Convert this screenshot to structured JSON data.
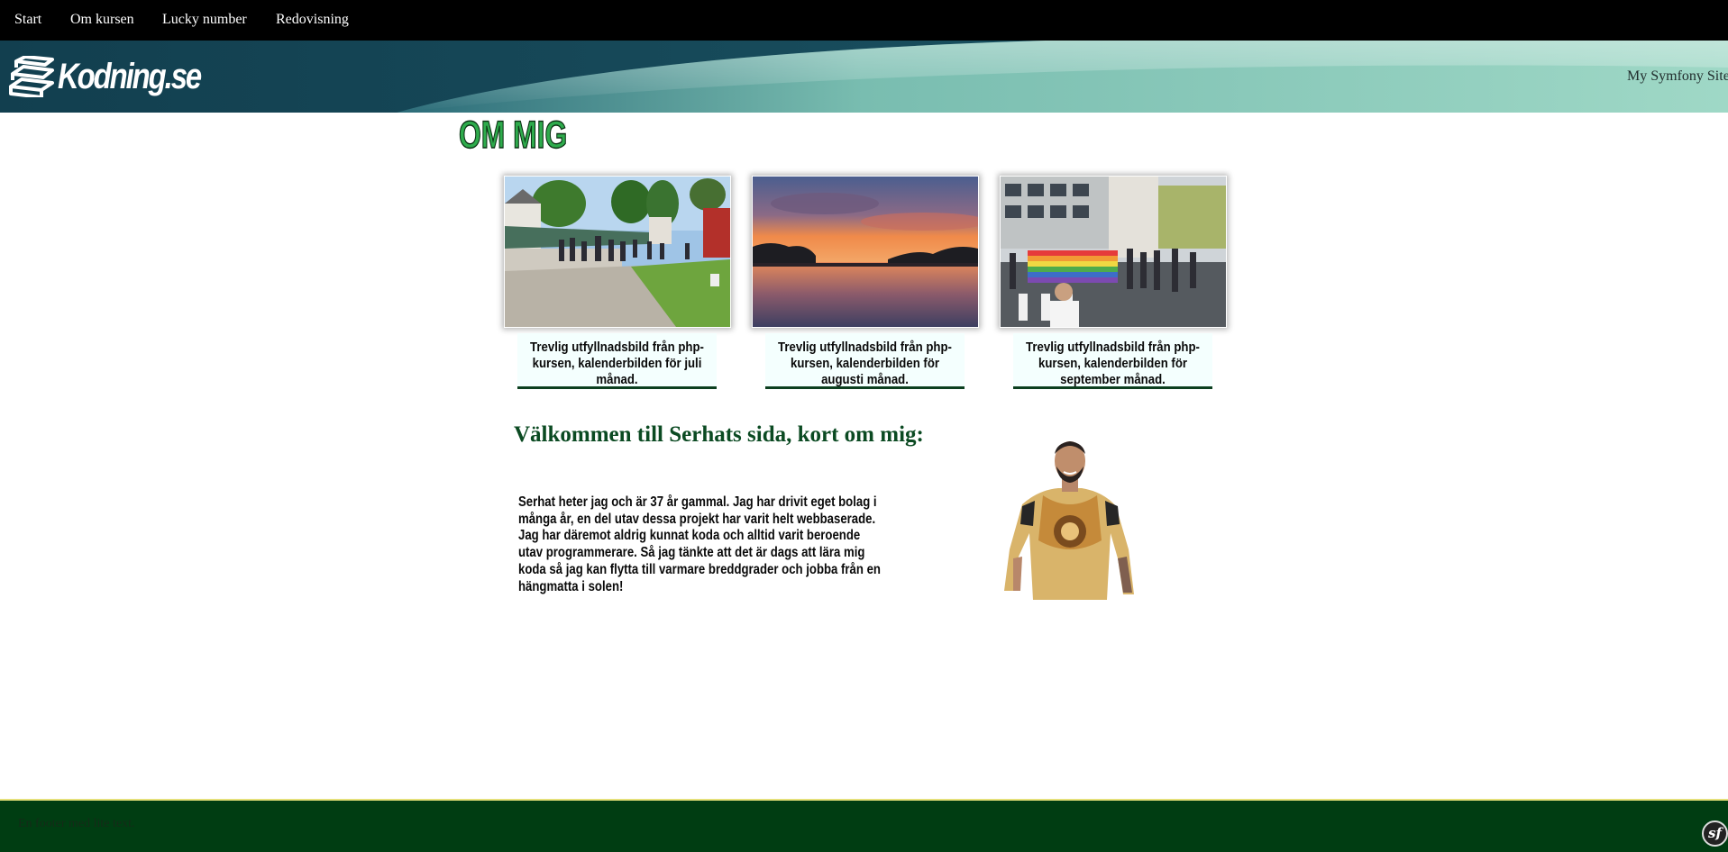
{
  "nav": {
    "items": [
      {
        "label": "Start"
      },
      {
        "label": "Om kursen"
      },
      {
        "label": "Lucky number"
      },
      {
        "label": "Redovisning"
      }
    ]
  },
  "header": {
    "logo_text": "Kodning.se",
    "site_name": "My Symfony Site"
  },
  "page": {
    "title": "OM MIG"
  },
  "gallery": [
    {
      "image": "market-street-photo",
      "caption": "Trevlig utfyllnadsbild från php-kursen, kalenderbilden för juli månad."
    },
    {
      "image": "lake-sunset-photo",
      "caption": "Trevlig utfyllnadsbild från php-kursen, kalenderbilden för augusti månad."
    },
    {
      "image": "pride-parade-photo",
      "caption": "Trevlig utfyllnadsbild från php-kursen, kalenderbilden för september månad."
    }
  ],
  "about": {
    "heading": "Välkommen till Serhats sida, kort om mig:",
    "text": "Serhat heter jag och är 37 år gammal. Jag har drivit eget bolag i många år, en del utav dessa projekt har varit helt webbaserade. Jag har däremot aldrig kunnat koda och alltid varit beroende utav programmerare. Så jag tänkte att det är dags att lära mig koda så jag kan flytta till varmare breddgrader och jobba från en hängmatta i solen!"
  },
  "footer": {
    "text": "En footer med lite text."
  },
  "colors": {
    "nav_bg": "#000000",
    "title_green": "#2eab4c",
    "heading_green": "#0b4a22",
    "footer_bg": "#003d12"
  }
}
